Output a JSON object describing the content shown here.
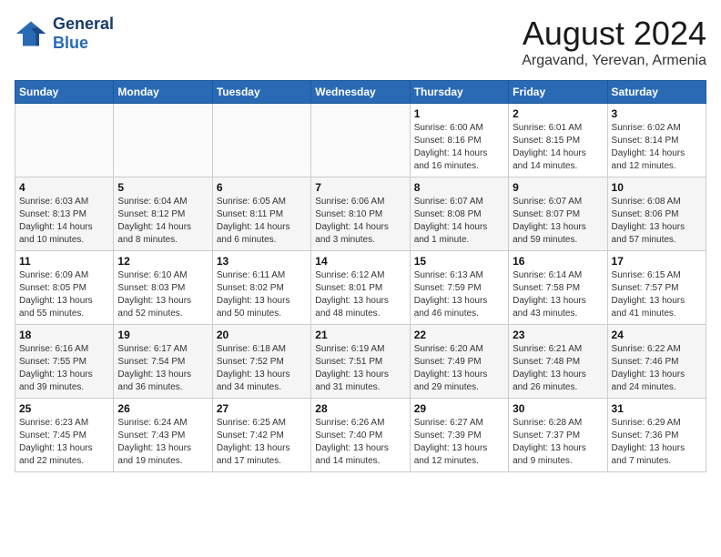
{
  "logo": {
    "line1": "General",
    "line2": "Blue"
  },
  "title": "August 2024",
  "subtitle": "Argavand, Yerevan, Armenia",
  "weekdays": [
    "Sunday",
    "Monday",
    "Tuesday",
    "Wednesday",
    "Thursday",
    "Friday",
    "Saturday"
  ],
  "weeks": [
    [
      {
        "day": "",
        "info": ""
      },
      {
        "day": "",
        "info": ""
      },
      {
        "day": "",
        "info": ""
      },
      {
        "day": "",
        "info": ""
      },
      {
        "day": "1",
        "info": "Sunrise: 6:00 AM\nSunset: 8:16 PM\nDaylight: 14 hours\nand 16 minutes."
      },
      {
        "day": "2",
        "info": "Sunrise: 6:01 AM\nSunset: 8:15 PM\nDaylight: 14 hours\nand 14 minutes."
      },
      {
        "day": "3",
        "info": "Sunrise: 6:02 AM\nSunset: 8:14 PM\nDaylight: 14 hours\nand 12 minutes."
      }
    ],
    [
      {
        "day": "4",
        "info": "Sunrise: 6:03 AM\nSunset: 8:13 PM\nDaylight: 14 hours\nand 10 minutes."
      },
      {
        "day": "5",
        "info": "Sunrise: 6:04 AM\nSunset: 8:12 PM\nDaylight: 14 hours\nand 8 minutes."
      },
      {
        "day": "6",
        "info": "Sunrise: 6:05 AM\nSunset: 8:11 PM\nDaylight: 14 hours\nand 6 minutes."
      },
      {
        "day": "7",
        "info": "Sunrise: 6:06 AM\nSunset: 8:10 PM\nDaylight: 14 hours\nand 3 minutes."
      },
      {
        "day": "8",
        "info": "Sunrise: 6:07 AM\nSunset: 8:08 PM\nDaylight: 14 hours\nand 1 minute."
      },
      {
        "day": "9",
        "info": "Sunrise: 6:07 AM\nSunset: 8:07 PM\nDaylight: 13 hours\nand 59 minutes."
      },
      {
        "day": "10",
        "info": "Sunrise: 6:08 AM\nSunset: 8:06 PM\nDaylight: 13 hours\nand 57 minutes."
      }
    ],
    [
      {
        "day": "11",
        "info": "Sunrise: 6:09 AM\nSunset: 8:05 PM\nDaylight: 13 hours\nand 55 minutes."
      },
      {
        "day": "12",
        "info": "Sunrise: 6:10 AM\nSunset: 8:03 PM\nDaylight: 13 hours\nand 52 minutes."
      },
      {
        "day": "13",
        "info": "Sunrise: 6:11 AM\nSunset: 8:02 PM\nDaylight: 13 hours\nand 50 minutes."
      },
      {
        "day": "14",
        "info": "Sunrise: 6:12 AM\nSunset: 8:01 PM\nDaylight: 13 hours\nand 48 minutes."
      },
      {
        "day": "15",
        "info": "Sunrise: 6:13 AM\nSunset: 7:59 PM\nDaylight: 13 hours\nand 46 minutes."
      },
      {
        "day": "16",
        "info": "Sunrise: 6:14 AM\nSunset: 7:58 PM\nDaylight: 13 hours\nand 43 minutes."
      },
      {
        "day": "17",
        "info": "Sunrise: 6:15 AM\nSunset: 7:57 PM\nDaylight: 13 hours\nand 41 minutes."
      }
    ],
    [
      {
        "day": "18",
        "info": "Sunrise: 6:16 AM\nSunset: 7:55 PM\nDaylight: 13 hours\nand 39 minutes."
      },
      {
        "day": "19",
        "info": "Sunrise: 6:17 AM\nSunset: 7:54 PM\nDaylight: 13 hours\nand 36 minutes."
      },
      {
        "day": "20",
        "info": "Sunrise: 6:18 AM\nSunset: 7:52 PM\nDaylight: 13 hours\nand 34 minutes."
      },
      {
        "day": "21",
        "info": "Sunrise: 6:19 AM\nSunset: 7:51 PM\nDaylight: 13 hours\nand 31 minutes."
      },
      {
        "day": "22",
        "info": "Sunrise: 6:20 AM\nSunset: 7:49 PM\nDaylight: 13 hours\nand 29 minutes."
      },
      {
        "day": "23",
        "info": "Sunrise: 6:21 AM\nSunset: 7:48 PM\nDaylight: 13 hours\nand 26 minutes."
      },
      {
        "day": "24",
        "info": "Sunrise: 6:22 AM\nSunset: 7:46 PM\nDaylight: 13 hours\nand 24 minutes."
      }
    ],
    [
      {
        "day": "25",
        "info": "Sunrise: 6:23 AM\nSunset: 7:45 PM\nDaylight: 13 hours\nand 22 minutes."
      },
      {
        "day": "26",
        "info": "Sunrise: 6:24 AM\nSunset: 7:43 PM\nDaylight: 13 hours\nand 19 minutes."
      },
      {
        "day": "27",
        "info": "Sunrise: 6:25 AM\nSunset: 7:42 PM\nDaylight: 13 hours\nand 17 minutes."
      },
      {
        "day": "28",
        "info": "Sunrise: 6:26 AM\nSunset: 7:40 PM\nDaylight: 13 hours\nand 14 minutes."
      },
      {
        "day": "29",
        "info": "Sunrise: 6:27 AM\nSunset: 7:39 PM\nDaylight: 13 hours\nand 12 minutes."
      },
      {
        "day": "30",
        "info": "Sunrise: 6:28 AM\nSunset: 7:37 PM\nDaylight: 13 hours\nand 9 minutes."
      },
      {
        "day": "31",
        "info": "Sunrise: 6:29 AM\nSunset: 7:36 PM\nDaylight: 13 hours\nand 7 minutes."
      }
    ]
  ]
}
